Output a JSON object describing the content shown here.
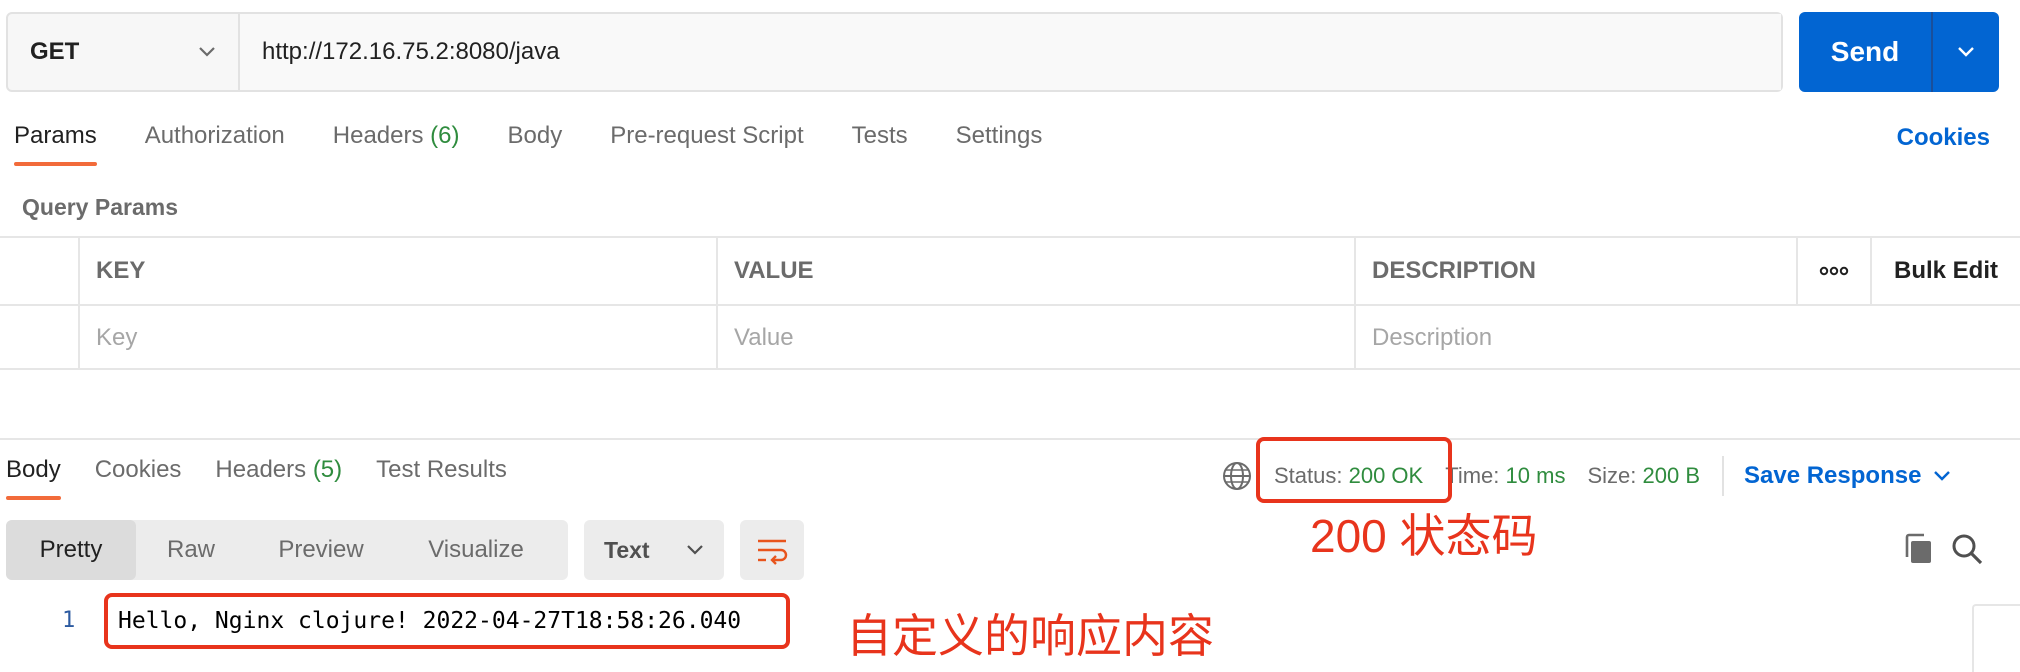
{
  "request": {
    "method": "GET",
    "url": "http://172.16.75.2:8080/java",
    "send_label": "Send"
  },
  "request_tabs": [
    {
      "label": "Params",
      "count": ""
    },
    {
      "label": "Authorization",
      "count": ""
    },
    {
      "label": "Headers",
      "count": "(6)"
    },
    {
      "label": "Body",
      "count": ""
    },
    {
      "label": "Pre-request Script",
      "count": ""
    },
    {
      "label": "Tests",
      "count": ""
    },
    {
      "label": "Settings",
      "count": ""
    }
  ],
  "cookies_link": "Cookies",
  "query_params": {
    "title": "Query Params",
    "headers": {
      "key": "KEY",
      "value": "VALUE",
      "description": "DESCRIPTION",
      "more": "ooo",
      "bulk_edit": "Bulk Edit"
    },
    "placeholders": {
      "key": "Key",
      "value": "Value",
      "description": "Description"
    }
  },
  "response_tabs": [
    {
      "label": "Body",
      "count": ""
    },
    {
      "label": "Cookies",
      "count": ""
    },
    {
      "label": "Headers",
      "count": "(5)"
    },
    {
      "label": "Test Results",
      "count": ""
    }
  ],
  "response_meta": {
    "status_label": "Status:",
    "status_value": "200 OK",
    "time_label": "Time:",
    "time_value": "10 ms",
    "size_label": "Size:",
    "size_value": "200 B",
    "save_response": "Save Response"
  },
  "format_options": [
    "Pretty",
    "Raw",
    "Preview",
    "Visualize"
  ],
  "format_selected": "Text",
  "body": {
    "line_number": "1",
    "line": "Hello, Nginx clojure! 2022-04-27T18:58:26.040"
  },
  "annotations": {
    "status_note": "200 状态码",
    "body_note": "自定义的响应内容",
    "color": "#e8341c"
  },
  "colors": {
    "accent_blue": "#0265d2",
    "tab_underline": "#f26b3a",
    "status_green": "#2f8c3e"
  }
}
